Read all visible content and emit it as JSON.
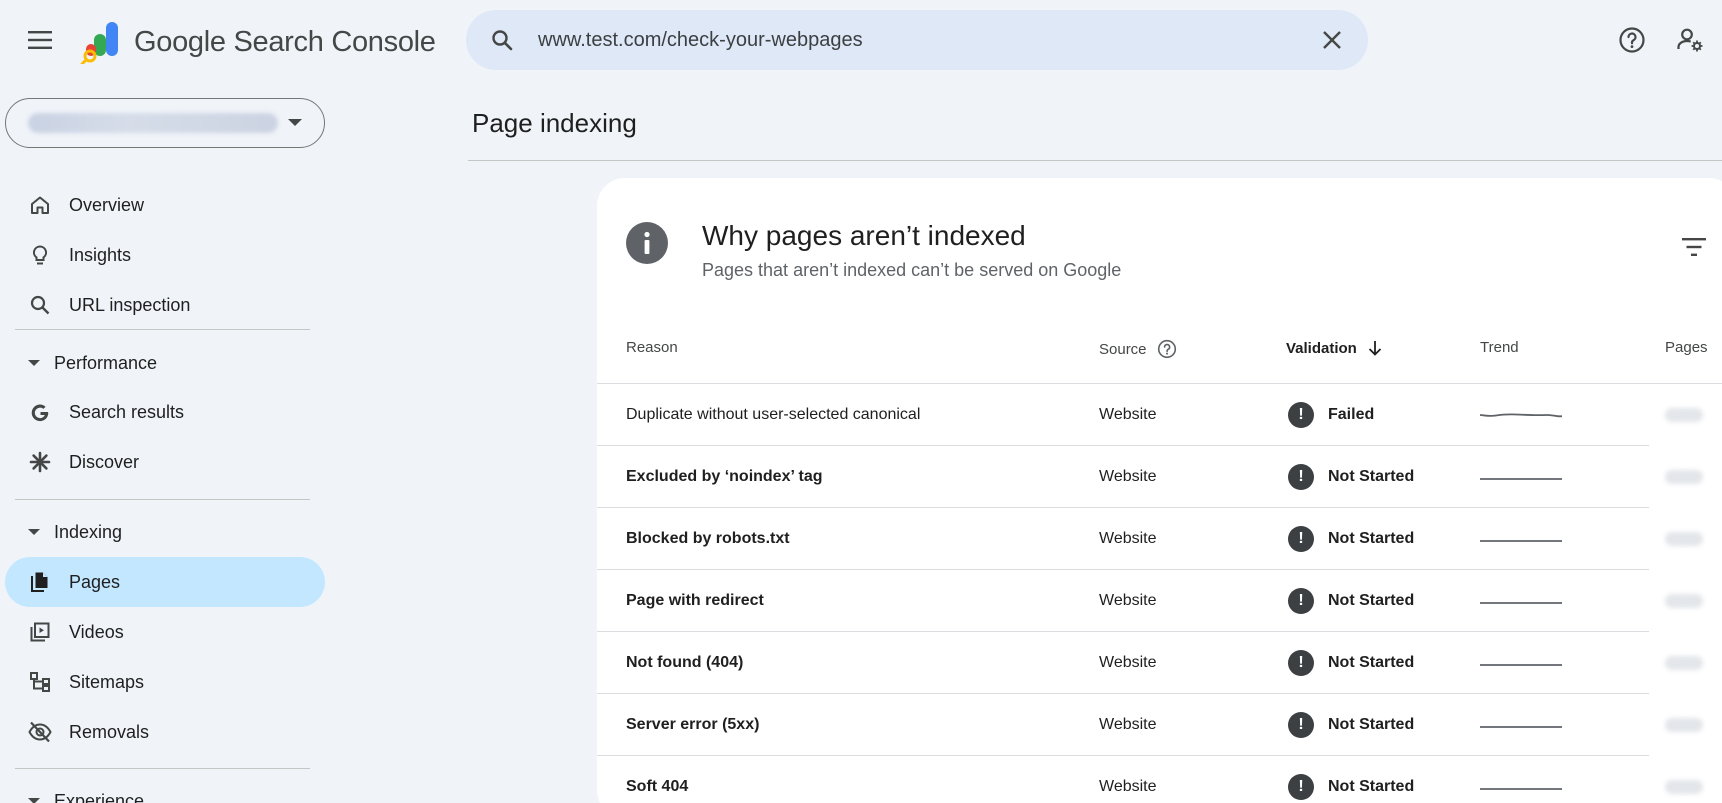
{
  "app": {
    "title": "Google Search Console"
  },
  "search": {
    "value": "www.test.com/check-your-webpages"
  },
  "sidebar": {
    "items": [
      {
        "label": "Overview",
        "icon": "home-icon"
      },
      {
        "label": "Insights",
        "icon": "lightbulb-icon"
      },
      {
        "label": "URL inspection",
        "icon": "search-icon"
      }
    ],
    "sections": [
      {
        "label": "Performance",
        "items": [
          {
            "label": "Search results",
            "icon": "google-g-icon"
          },
          {
            "label": "Discover",
            "icon": "asterisk-icon"
          }
        ]
      },
      {
        "label": "Indexing",
        "items": [
          {
            "label": "Pages",
            "icon": "pages-icon",
            "active": true
          },
          {
            "label": "Videos",
            "icon": "video-library-icon"
          },
          {
            "label": "Sitemaps",
            "icon": "sitemap-icon"
          },
          {
            "label": "Removals",
            "icon": "eye-off-icon"
          }
        ]
      },
      {
        "label": "Experience"
      }
    ]
  },
  "main": {
    "page_title": "Page indexing",
    "card": {
      "title": "Why pages aren’t indexed",
      "subtitle": "Pages that aren’t indexed can’t be served on Google",
      "columns": {
        "reason": "Reason",
        "source": "Source",
        "validation": "Validation",
        "trend": "Trend",
        "pages": "Pages"
      },
      "rows": [
        {
          "reason": "Duplicate without user-selected canonical",
          "source": "Website",
          "validation": "Failed"
        },
        {
          "reason": "Excluded by ‘noindex’ tag",
          "source": "Website",
          "validation": "Not Started"
        },
        {
          "reason": "Blocked by robots.txt",
          "source": "Website",
          "validation": "Not Started"
        },
        {
          "reason": "Page with redirect",
          "source": "Website",
          "validation": "Not Started"
        },
        {
          "reason": "Not found (404)",
          "source": "Website",
          "validation": "Not Started"
        },
        {
          "reason": "Server error (5xx)",
          "source": "Website",
          "validation": "Not Started"
        },
        {
          "reason": "Soft 404",
          "source": "Website",
          "validation": "Not Started"
        }
      ]
    }
  },
  "colors": {
    "background": "#f0f4f9",
    "search_bg": "#dfe8f7",
    "active_nav": "#c2e7ff",
    "card_bg": "#ffffff",
    "status_icon": "#3c4043"
  }
}
